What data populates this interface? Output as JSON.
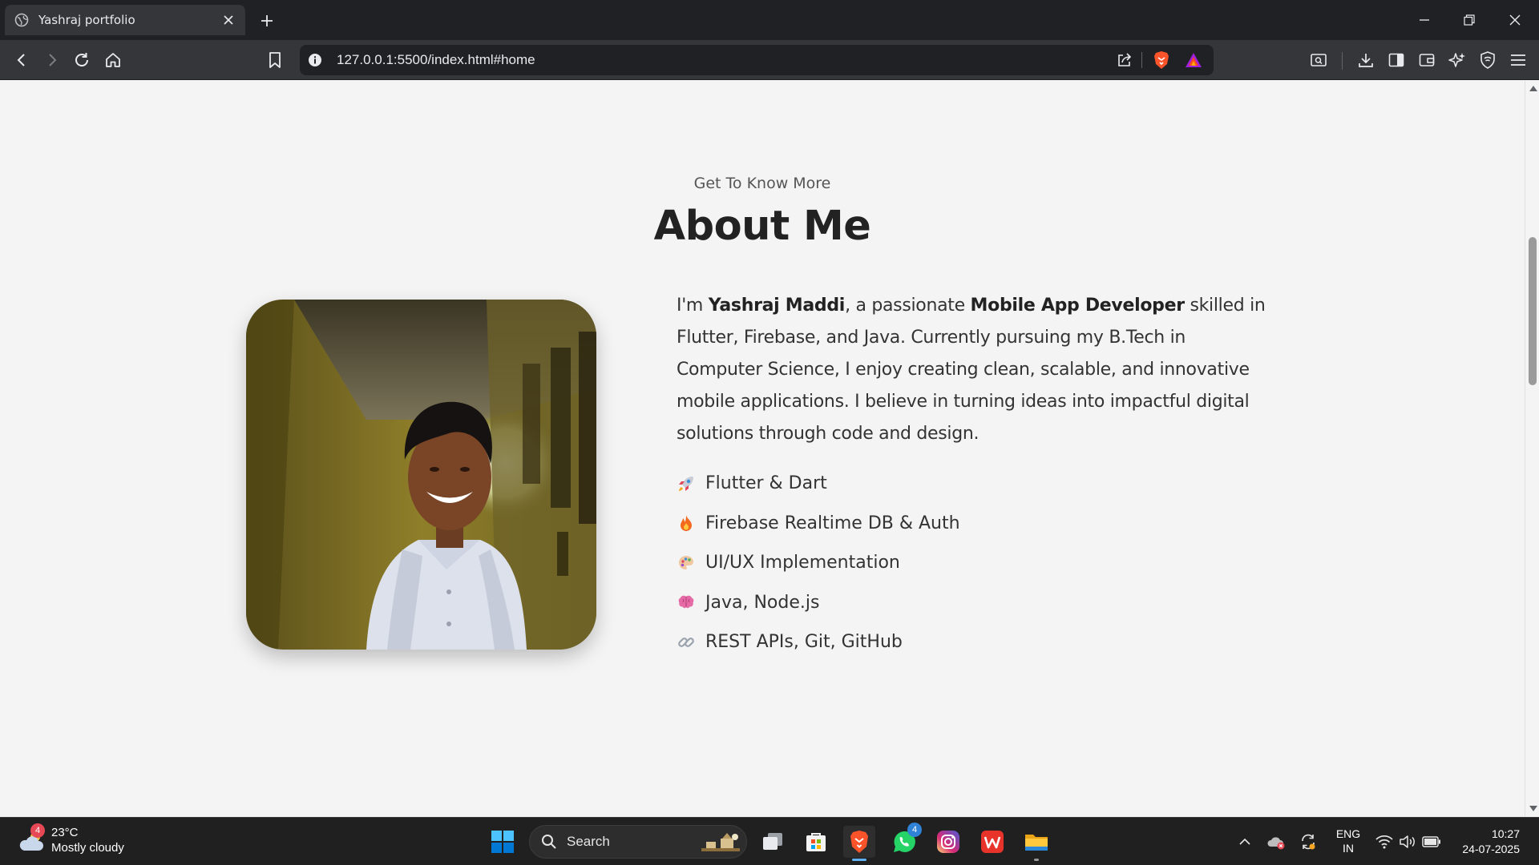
{
  "browser": {
    "tab_title": "Yashraj portfolio",
    "url": "127.0.0.1:5500/index.html#home"
  },
  "about": {
    "subtitle": "Get To Know More",
    "title": "About Me",
    "intro_1": "I'm ",
    "name": "Yashraj Maddi",
    "intro_2": ", a passionate ",
    "role": "Mobile App Developer",
    "intro_3": " skilled in Flutter, Firebase, and Java. Currently pursuing my B.Tech in Computer Science, I enjoy creating clean, scalable, and innovative mobile applications. I believe in turning ideas into impactful digital solutions through code and design.",
    "skills": [
      {
        "icon": "rocket-icon",
        "label": "Flutter & Dart"
      },
      {
        "icon": "fire-icon",
        "label": "Firebase Realtime DB & Auth"
      },
      {
        "icon": "palette-icon",
        "label": "UI/UX Implementation"
      },
      {
        "icon": "brain-icon",
        "label": "Java, Node.js"
      },
      {
        "icon": "link-icon",
        "label": "REST APIs, Git, GitHub"
      }
    ]
  },
  "taskbar": {
    "weather_badge": "4",
    "temperature": "23°C",
    "condition": "Mostly cloudy",
    "search_label": "Search",
    "whatsapp_badge": "4",
    "lang_1": "ENG",
    "lang_2": "IN",
    "time": "10:27",
    "date": "24-07-2025"
  },
  "colors": {
    "page_bg": "#f4f4f4",
    "heading": "#222222",
    "body_text": "#333333",
    "chrome_dark": "#202124",
    "chrome_toolbar": "#35363a",
    "taskbar_bg": "#202020"
  }
}
